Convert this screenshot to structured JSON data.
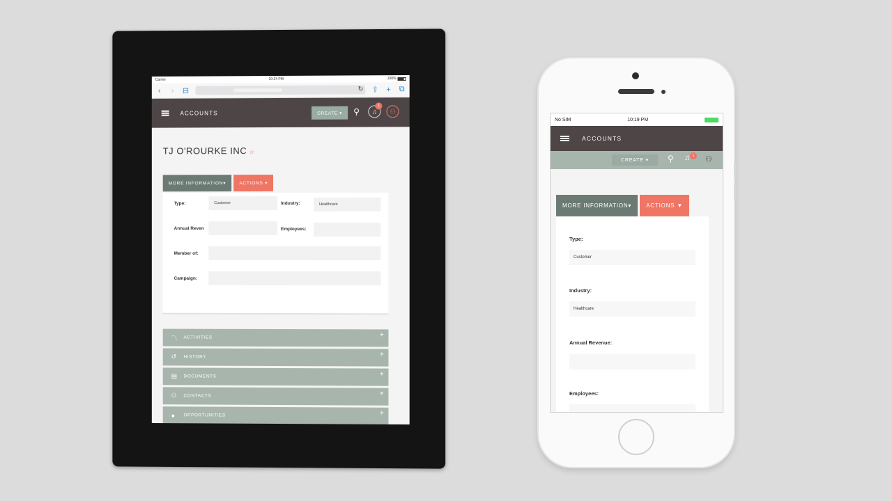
{
  "tablet": {
    "status": {
      "carrier": "Carrier",
      "time": "10:24 PM",
      "battery": "100%"
    },
    "header": {
      "title": "ACCOUNTS",
      "create_label": "CREATE ▾",
      "notif_count": "1"
    },
    "record": {
      "name": "TJ O'ROURKE INC",
      "star": "☆"
    },
    "tabs": {
      "more": "MORE INFORMATION▾",
      "actions": "ACTIONS ▾"
    },
    "fields": {
      "type_label": "Type:",
      "type_value": "Customer",
      "industry_label": "Industry:",
      "industry_value": "Healthcare",
      "annual_label": "Annual Reven",
      "employees_label": "Employees:",
      "member_label": "Member of:",
      "campaign_label": "Campaign:"
    },
    "subpanels": [
      "ACTIVITIES",
      "HISTORY",
      "DOCUMENTS",
      "CONTACTS",
      "OPPORTUNITIES"
    ]
  },
  "phone": {
    "status": {
      "carrier": "No SIM",
      "time": "10:19 PM"
    },
    "header": {
      "title": "ACCOUNTS",
      "create_label": "CREATE ▾",
      "notif_count": "1"
    },
    "tabs": {
      "more": "MORE INFORMATION▾",
      "actions": "ACTIONS ▼"
    },
    "fields": {
      "type_label": "Type:",
      "type_value": "Customer",
      "industry_label": "Industry:",
      "industry_value": "Healthcare",
      "annual_label": "Annual Revenue:",
      "employees_label": "Employees:"
    }
  },
  "colors": {
    "header": "#4d4546",
    "accent": "#ef7565",
    "sage": "#a8b5ad",
    "sage_dark": "#6b7b73"
  }
}
